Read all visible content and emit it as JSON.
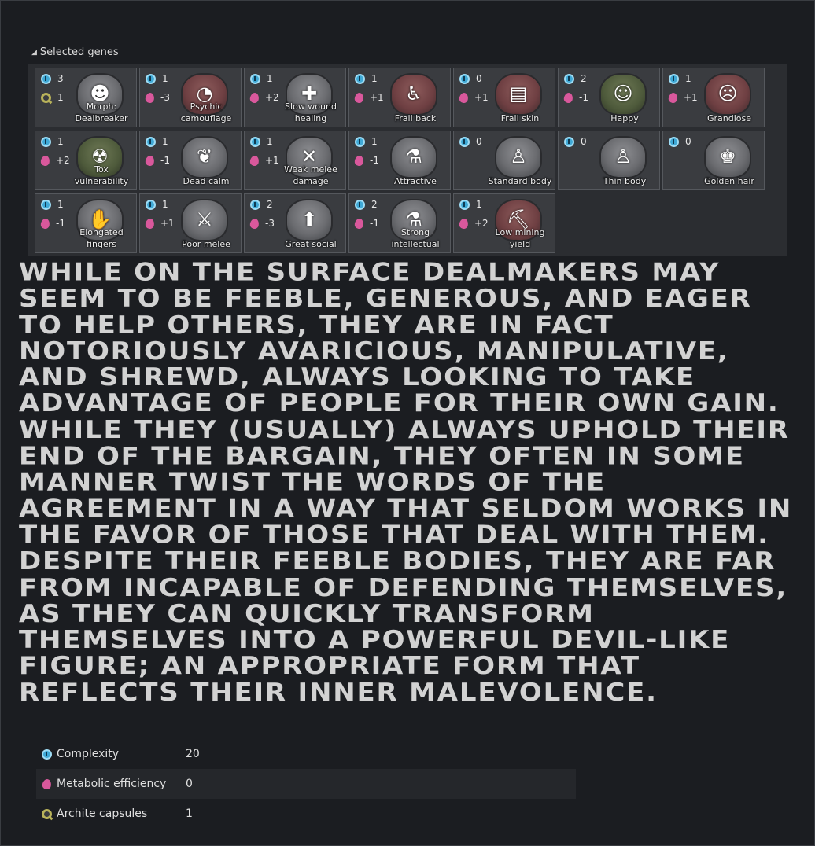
{
  "section": {
    "title": "Selected genes"
  },
  "genes": [
    {
      "label": "Morph:\nDealbreaker",
      "complexity": "3",
      "second_type": "archite",
      "second": "1",
      "icon": "morph-icon",
      "glyph": "☻",
      "tint": "gray"
    },
    {
      "label": "Psychic\ncamouflage",
      "complexity": "1",
      "second_type": "metabolic",
      "second": "-3",
      "icon": "psychic-camouflage-icon",
      "glyph": "◔",
      "tint": "red"
    },
    {
      "label": "Slow wound\nhealing",
      "complexity": "1",
      "second_type": "metabolic",
      "second": "+2",
      "icon": "medical-cross-icon",
      "glyph": "✚",
      "tint": "gray"
    },
    {
      "label": "Frail back",
      "complexity": "1",
      "second_type": "metabolic",
      "second": "+1",
      "icon": "frail-back-icon",
      "glyph": "♿",
      "tint": "red"
    },
    {
      "label": "Frail skin",
      "complexity": "0",
      "second_type": "metabolic",
      "second": "+1",
      "icon": "skin-scroll-icon",
      "glyph": "▤",
      "tint": "red"
    },
    {
      "label": "Happy",
      "complexity": "2",
      "second_type": "metabolic",
      "second": "-1",
      "icon": "happy-face-icon",
      "glyph": "☺",
      "tint": "green"
    },
    {
      "label": "Grandiose",
      "complexity": "1",
      "second_type": "metabolic",
      "second": "+1",
      "icon": "grandiose-face-icon",
      "glyph": "☹",
      "tint": "red"
    },
    {
      "label": "Tox\nvulnerability",
      "complexity": "1",
      "second_type": "metabolic",
      "second": "+2",
      "icon": "toxic-hazard-icon",
      "glyph": "☢",
      "tint": "green"
    },
    {
      "label": "Dead calm",
      "complexity": "1",
      "second_type": "metabolic",
      "second": "-1",
      "icon": "lotus-icon",
      "glyph": "❦",
      "tint": "gray"
    },
    {
      "label": "Weak melee\ndamage",
      "complexity": "1",
      "second_type": "metabolic",
      "second": "+1",
      "icon": "broken-fist-icon",
      "glyph": "✕",
      "tint": "gray"
    },
    {
      "label": "Attractive",
      "complexity": "1",
      "second_type": "metabolic",
      "second": "-1",
      "icon": "potion-icon",
      "glyph": "⚗",
      "tint": "gray"
    },
    {
      "label": "Standard body",
      "complexity": "0",
      "second_type": "none",
      "second": "",
      "icon": "standard-body-icon",
      "glyph": "♙",
      "tint": "gray"
    },
    {
      "label": "Thin body",
      "complexity": "0",
      "second_type": "none",
      "second": "",
      "icon": "thin-body-icon",
      "glyph": "♙",
      "tint": "gray"
    },
    {
      "label": "Golden hair",
      "complexity": "0",
      "second_type": "none",
      "second": "",
      "icon": "golden-hair-icon",
      "glyph": "♚",
      "tint": "gray"
    },
    {
      "label": "Elongated\nfingers",
      "complexity": "1",
      "second_type": "metabolic",
      "second": "-1",
      "icon": "hand-icon",
      "glyph": "✋",
      "tint": "gray"
    },
    {
      "label": "Poor melee",
      "complexity": "1",
      "second_type": "metabolic",
      "second": "+1",
      "icon": "broken-sword-icon",
      "glyph": "⚔",
      "tint": "gray"
    },
    {
      "label": "Great social",
      "complexity": "2",
      "second_type": "metabolic",
      "second": "-3",
      "icon": "social-up-icon",
      "glyph": "⬆",
      "tint": "gray"
    },
    {
      "label": "Strong\nintellectual",
      "complexity": "2",
      "second_type": "metabolic",
      "second": "-1",
      "icon": "flask-up-icon",
      "glyph": "⚗",
      "tint": "gray"
    },
    {
      "label": "Low mining\nyield",
      "complexity": "1",
      "second_type": "metabolic",
      "second": "+2",
      "icon": "pickaxe-icon",
      "glyph": "⛏",
      "tint": "red"
    }
  ],
  "description": "While on the surface dealmakers may seem to be feeble, generous, and eager to help others, they are in fact notoriously avaricious, manipulative, and shrewd, always looking to take advantage of people for their own gain. While they (usually) always uphold their end of the bargain, they often in some manner twist the words of the agreement in a way that seldom works in the favor of those that deal with them. Despite their feeble bodies, they are far from incapable of defending themselves, as they can quickly transform themselves into a powerful devil-like figure; an appropriate form that reflects their inner malevolence.",
  "stats": [
    {
      "icon": "complexity-icon",
      "name": "Complexity",
      "value": "20"
    },
    {
      "icon": "metabolic-icon",
      "name": "Metabolic efficiency",
      "value": "0"
    },
    {
      "icon": "archite-icon",
      "name": "Archite capsules",
      "value": "1"
    }
  ],
  "colors": {
    "background": "#1b1d21",
    "complexity": "#3fa9d6",
    "metabolic": "#d9589c",
    "archite": "#b8b25a"
  }
}
